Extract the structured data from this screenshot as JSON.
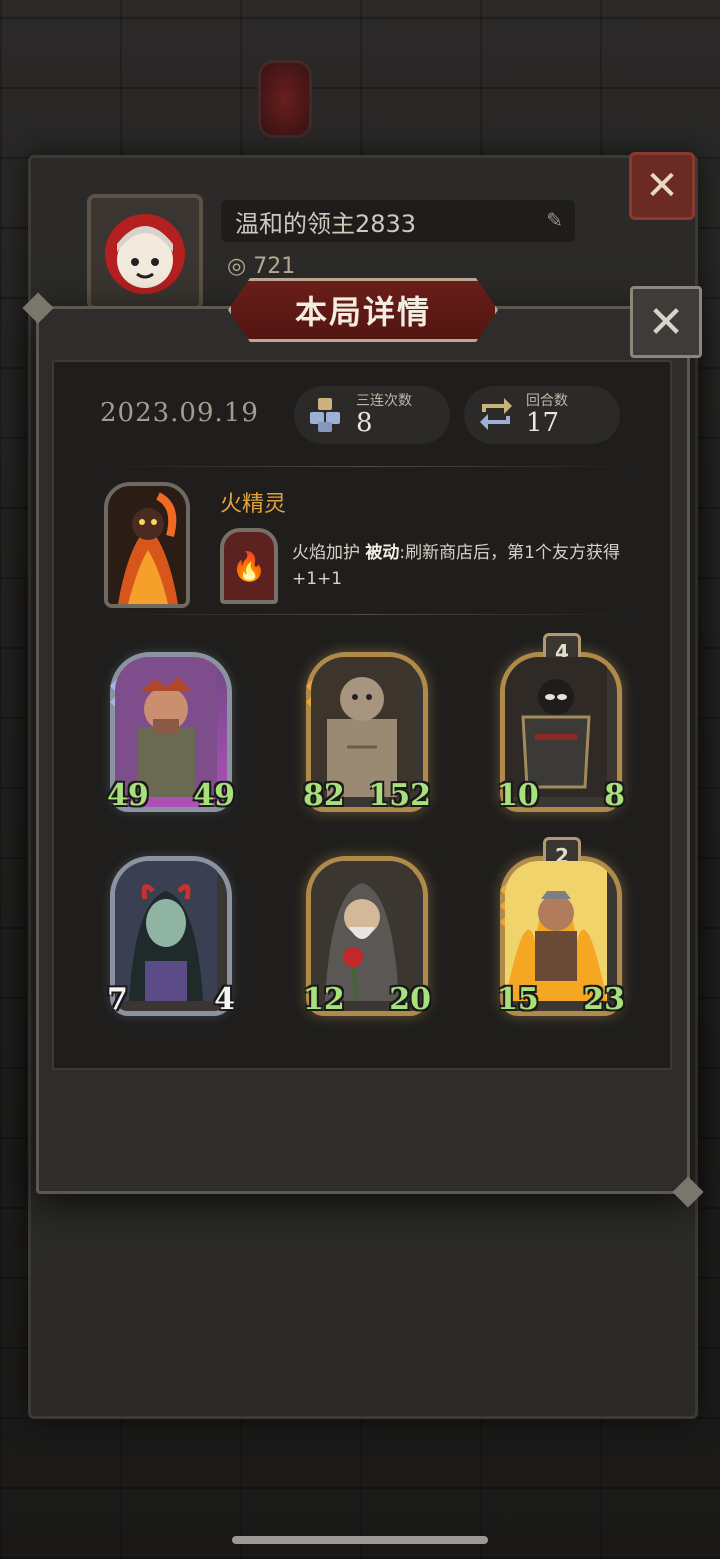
{
  "background_profile": {
    "player_name": "温和的领主2833",
    "coins": "721"
  },
  "modal": {
    "title": "本局详情",
    "date": "2023.09.19",
    "triple_label": "三连次数",
    "triple_value": "8",
    "rounds_label": "回合数",
    "rounds_value": "17"
  },
  "hero": {
    "name": "火精灵",
    "skill_name": "火焰加护",
    "skill_type": "被动",
    "skill_text": ":刷新商店后，第1个友方获得+1+1"
  },
  "cards": [
    {
      "atk": "49",
      "hp": "49",
      "frame": "silver",
      "tier": ""
    },
    {
      "atk": "82",
      "hp": "152",
      "frame": "gold",
      "tier": ""
    },
    {
      "atk": "10",
      "hp": "8",
      "frame": "gold",
      "tier": "4"
    },
    {
      "atk": "7",
      "hp": "4",
      "frame": "silver",
      "tier": ""
    },
    {
      "atk": "12",
      "hp": "20",
      "frame": "gold",
      "tier": ""
    },
    {
      "atk": "15",
      "hp": "23",
      "frame": "gold",
      "tier": "2"
    }
  ],
  "colors": {
    "accent_orange": "#e3a23c",
    "stat_green": "#a8e07c",
    "banner_red": "#6a1e19"
  },
  "icons": {
    "close": "close-icon",
    "edit": "pencil-icon",
    "triple": "cubes-icon",
    "rounds": "cycle-arrows-icon",
    "skill": "flame-icon"
  }
}
